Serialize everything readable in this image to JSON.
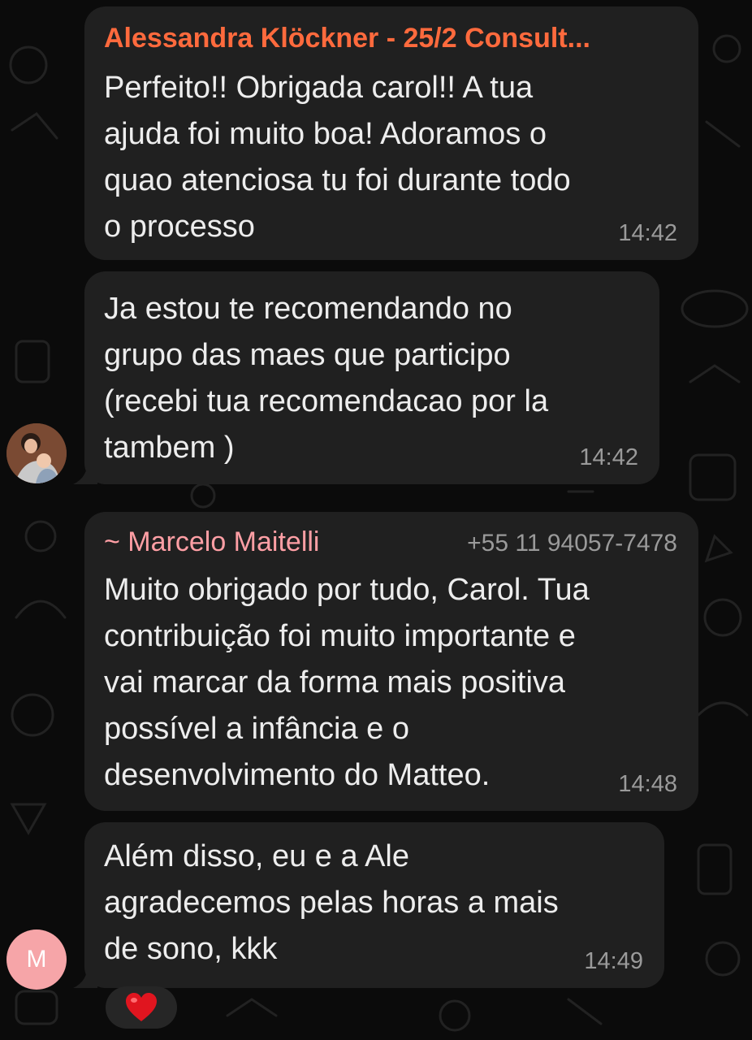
{
  "colors": {
    "background": "#0b0b0b",
    "bubble": "#202020",
    "sender_alessandra": "#ff6a3d",
    "sender_marcelo": "#ff9fa5",
    "timestamp": "#9a9a9a",
    "avatar_m": "#f6a5a8"
  },
  "messages": [
    {
      "sender": "Alessandra Klöckner - 25/2 Consult...",
      "text": "Perfeito!! Obrigada carol!! A tua\najuda foi muito boa! Adoramos o\nquao atenciosa tu foi durante todo\no processo",
      "time": "14:42"
    },
    {
      "text": "Ja estou te recomendando no\ngrupo das maes que participo\n(recebi tua recomendacao por la\ntambem )",
      "time": "14:42",
      "avatar": "user-photo"
    },
    {
      "sender": "~ Marcelo Maitelli",
      "phone": "+55 11 94057-7478",
      "text": "Muito obrigado por tudo, Carol. Tua\ncontribuição foi muito importante e\nvai marcar da forma mais positiva\npossível a infância e o\ndesenvolvimento do Matteo.",
      "time": "14:48"
    },
    {
      "text": "Além disso, eu e a Ale\nagradecemos pelas horas a mais\nde sono, kkk",
      "time": "14:49",
      "avatar_initial": "M",
      "reaction": "heart-emoji"
    }
  ]
}
